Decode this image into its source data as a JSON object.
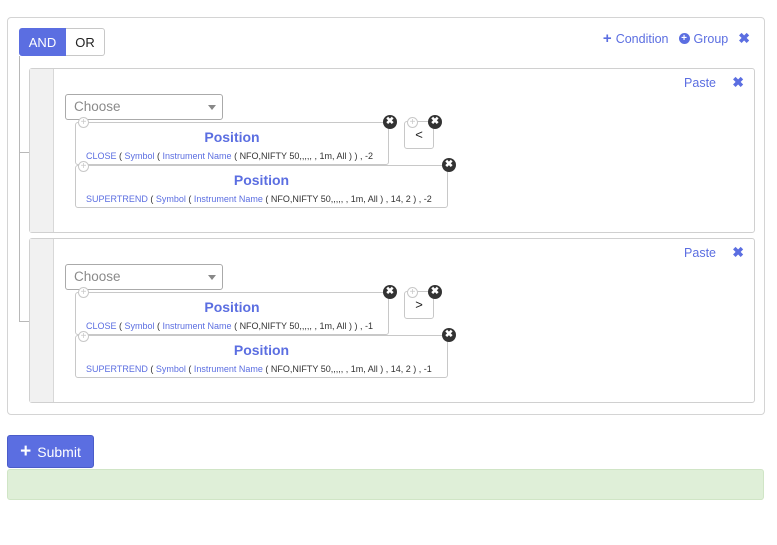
{
  "logic": {
    "and_label": "AND",
    "or_label": "OR",
    "selected": "AND"
  },
  "top_actions": {
    "condition_label": "Condition",
    "group_label": "Group"
  },
  "rules": [
    {
      "paste_label": "Paste",
      "choose_placeholder": "Choose",
      "operator": "<",
      "left": {
        "title": "Position",
        "fn": "CLOSE",
        "symbol": "Symbol",
        "instrument": "Instrument Name",
        "instrument_value": "NFO,NIFTY 50,,,,,",
        "args": ", 1m, All ) ) , -2"
      },
      "right": {
        "title": "Position",
        "fn": "SUPERTREND",
        "symbol": "Symbol",
        "instrument": "Instrument Name",
        "instrument_value": "NFO,NIFTY 50,,,,,",
        "args": ", 1m, All ) , 14, 2 ) , -2"
      }
    },
    {
      "paste_label": "Paste",
      "choose_placeholder": "Choose",
      "operator": ">",
      "left": {
        "title": "Position",
        "fn": "CLOSE",
        "symbol": "Symbol",
        "instrument": "Instrument Name",
        "instrument_value": "NFO,NIFTY 50,,,,,",
        "args": ", 1m, All ) ) , -1"
      },
      "right": {
        "title": "Position",
        "fn": "SUPERTREND",
        "symbol": "Symbol",
        "instrument": "Instrument Name",
        "instrument_value": "NFO,NIFTY 50,,,,,",
        "args": ", 1m, All ) , 14, 2 ) , -1"
      }
    }
  ],
  "submit_label": "Submit",
  "colors": {
    "accent": "#5b6ee1",
    "success_bg": "#dfefd8"
  }
}
